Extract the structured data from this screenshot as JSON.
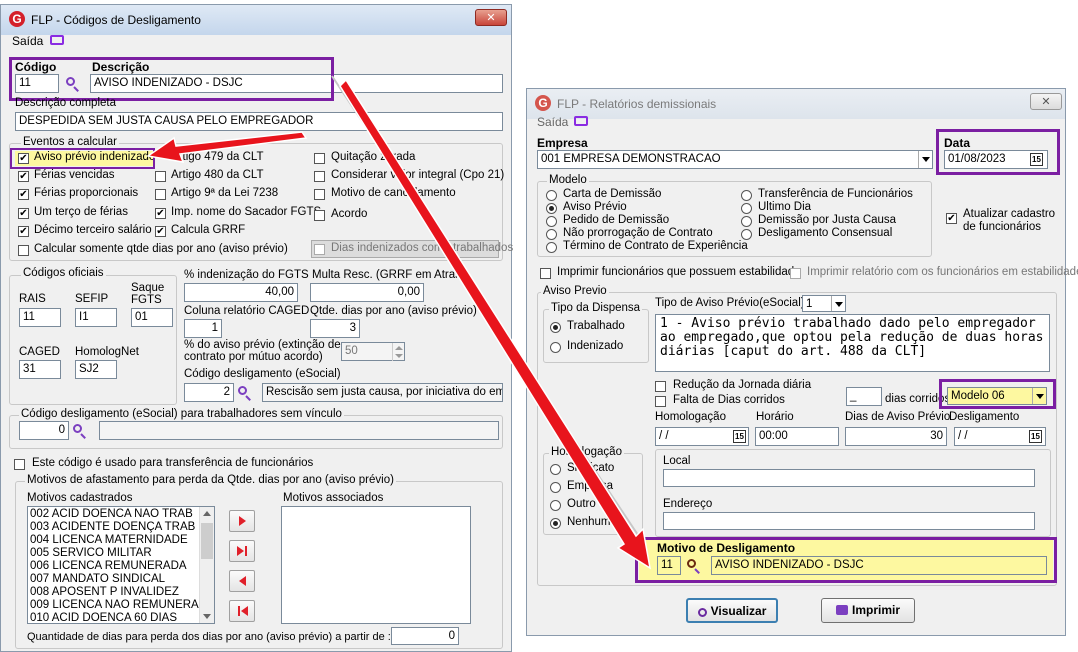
{
  "win1": {
    "title": "FLP - Códigos de Desligamento",
    "close": "✕",
    "menu_saida": "Saída",
    "codigo_label": "Código",
    "descricao_label": "Descrição",
    "codigo_value": "11",
    "descricao_value": "AVISO INDENIZADO - DSJC",
    "descricao_completa_label": "Descrição completa",
    "descricao_completa_value": "DESPEDIDA SEM JUSTA CAUSA PELO EMPREGADOR",
    "eventos_title": "Eventos a calcular",
    "ev_aviso": "Aviso prévio indenizado",
    "ev_ferias_vencidas": "Férias vencidas",
    "ev_ferias_prop": "Férias proporcionais",
    "ev_terco": "Um terço de férias",
    "ev_decimo": "Décimo terceiro salário",
    "ev_calcular_dias": "Calcular somente qtde dias por ano (aviso prévio)",
    "ev_art479": "Artigo 479 da CLT",
    "ev_art480": "Artigo 480 da CLT",
    "ev_art9": "Artigo 9ª da Lei 7238",
    "ev_imp_nome": "Imp. nome do Sacador FGTS",
    "ev_calcula_grrf": "Calcula GRRF",
    "ev_quitacao": "Quitação zerada",
    "ev_considerar": "Considerar valor integral (Cpo 21)",
    "ev_motivo_canc": "Motivo de cancelamento",
    "ev_acordo": "Acordo",
    "ev_dias_indenizados": "Dias indenizados como trabalhados",
    "codigos_oficiais_title": "Códigos oficiais",
    "rais_label": "RAIS",
    "rais_value": "11",
    "sefip_label": "SEFIP",
    "sefip_value": "I1",
    "saque_label": "Saque\nFGTS",
    "saque_value": "01",
    "caged_label": "CAGED",
    "caged_value": "31",
    "homolog_label": "HomologNet",
    "homolog_value": "SJ2",
    "pct_fgts_label": "% indenização do FGTS",
    "pct_fgts_value": "40,00",
    "multa_label": "Multa Resc. (GRRF em Atraso)",
    "multa_value": "0,00",
    "coluna_caged_label": "Coluna relatório CAGED",
    "coluna_caged_value": "1",
    "qtde_dias_label": "Qtde. dias por ano (aviso prévio)",
    "qtde_dias_value": "3",
    "pct_aviso_label": "% do aviso prévio (extinção de\ncontrato por mútuo acordo)",
    "pct_aviso_value": "50",
    "codigo_esocial_label": "Código desligamento (eSocial)",
    "codigo_esocial_value": "2",
    "codigo_esocial_desc": "Rescisão sem justa causa, por iniciativa do empre",
    "sem_vinculo_title": "Código desligamento (eSocial) para trabalhadores sem vínculo",
    "sem_vinculo_value": "0",
    "transferencia_label": "Este código é usado para transferência de funcionários",
    "motivos_title": "Motivos de afastamento para perda da Qtde. dias por ano (aviso prévio)",
    "motivos_cadastrados_label": "Motivos cadastrados",
    "motivos_associados_label": "Motivos associados",
    "motivos": [
      "002 ACID DOENCA NAO TRAB",
      "003 ACIDENTE DOENÇA TRAB",
      "004 LICENCA MATERNIDADE",
      "005 SERVICO MILITAR",
      "006 LICENCA REMUNERADA",
      "007 MANDATO SINDICAL",
      "008 APOSENT P INVALIDEZ",
      "009 LICENCA NAO REMUNERA",
      "010 ACID DOENCA 60 DIAS"
    ],
    "qtde_perda_label": "Quantidade de dias para perda dos dias por ano (aviso prévio) a  partir de :",
    "qtde_perda_value": "0"
  },
  "win2": {
    "title": "FLP - Relatórios demissionais",
    "close": "✕",
    "menu_saida": "Saída",
    "empresa_label": "Empresa",
    "empresa_value": "001 EMPRESA DEMONSTRACAO",
    "data_label": "Data",
    "data_value": "01/08/2023",
    "modelo_title": "Modelo",
    "modelos_left": [
      "Carta de Demissão",
      "Aviso Prévio",
      "Pedido de Demissão",
      "Não prorrogação de Contrato",
      "Término de Contrato de Experiência"
    ],
    "modelos_right": [
      "Transferência de Funcionários",
      "Ultimo Dia",
      "Demissão por Justa Causa",
      "Desligamento Consensual"
    ],
    "atualizar_label": "Atualizar cadastro\nde funcionários",
    "imprimir_estab": "Imprimir funcionários que possuem estabilidade",
    "imprimir_rel_estab": "Imprimir relatório com os funcionários em estabilidade",
    "aviso_previo_title": "Aviso Previo",
    "tipo_dispensa_title": "Tipo da Dispensa",
    "trabalhado": "Trabalhado",
    "indenizado": "Indenizado",
    "tipo_aviso_label": "Tipo de Aviso Prévio(eSocial):",
    "tipo_aviso_value": "1",
    "aviso_text": "1 - Aviso prévio trabalhado dado pelo empregador ao empregado,que optou pela redução de duas horas diárias [caput do art. 488 da CLT]",
    "reducao_jornada": "Redução da Jornada diária",
    "falta_dias": "Falta de Dias corridos",
    "dias_corridos_value": "_",
    "dias_corridos_label": "dias corridos",
    "modelo_value": "Modelo 06",
    "homologacao_label": "Homologação",
    "horario_label": "Horário",
    "dias_aviso_label": "Dias de Aviso Prévio",
    "desligamento_label": "Desligamento",
    "homologacao_value": " / /",
    "horario_value": "00:00",
    "dias_aviso_value": "30",
    "desligamento_value": " / /",
    "homologacao_group_title": "Homologação",
    "homolog_opts": [
      "Sindicato",
      "Empresa",
      "Outro",
      "Nenhum"
    ],
    "local_label": "Local",
    "endereco_label": "Endereço",
    "motivo_label": "Motivo de Desligamento",
    "motivo_code": "11",
    "motivo_desc": "AVISO INDENIZADO - DSJC",
    "visualizar": "Visualizar",
    "imprimir": "Imprimir"
  },
  "colors": {
    "highlight": "#7b1fa2",
    "arrow": "#e8141c",
    "yellow": "#fdf8a0"
  }
}
